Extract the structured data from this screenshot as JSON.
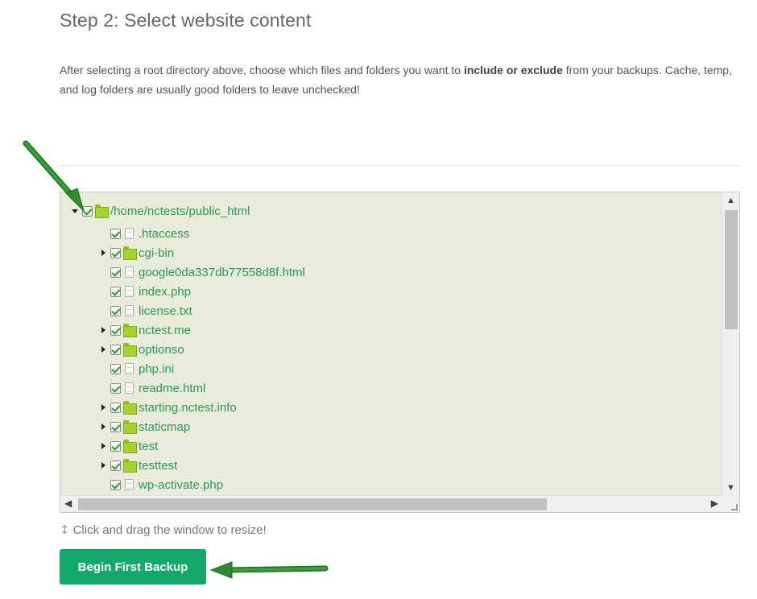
{
  "step": {
    "title": "Step 2: Select website content",
    "description_before": "After selecting a root directory above, choose which files and folders you want to ",
    "description_bold": "include or exclude",
    "description_after": " from your backups. Cache, temp, and log folders are usually good folders to leave unchecked!"
  },
  "tree": {
    "root": {
      "label": "/home/nctests/public_html",
      "icon": "folder-icon",
      "expanded": true,
      "checked": true
    },
    "items": [
      {
        "label": ".htaccess",
        "type": "file",
        "checked": true,
        "expandable": false
      },
      {
        "label": "cgi-bin",
        "type": "folder",
        "checked": true,
        "expandable": true
      },
      {
        "label": "google0da337db77558d8f.html",
        "type": "file",
        "checked": true,
        "expandable": false
      },
      {
        "label": "index.php",
        "type": "file",
        "checked": true,
        "expandable": false
      },
      {
        "label": "license.txt",
        "type": "file",
        "checked": true,
        "expandable": false
      },
      {
        "label": "nctest.me",
        "type": "folder",
        "checked": true,
        "expandable": true
      },
      {
        "label": "optionso",
        "type": "folder",
        "checked": true,
        "expandable": true
      },
      {
        "label": "php.ini",
        "type": "file",
        "checked": true,
        "expandable": false
      },
      {
        "label": "readme.html",
        "type": "file",
        "checked": true,
        "expandable": false
      },
      {
        "label": "starting.nctest.info",
        "type": "folder",
        "checked": true,
        "expandable": true
      },
      {
        "label": "staticmap",
        "type": "folder",
        "checked": true,
        "expandable": true
      },
      {
        "label": "test",
        "type": "folder",
        "checked": true,
        "expandable": true
      },
      {
        "label": "testtest",
        "type": "folder",
        "checked": true,
        "expandable": true
      },
      {
        "label": "wp-activate.php",
        "type": "file",
        "checked": true,
        "expandable": false
      }
    ]
  },
  "resize_hint": "Click and drag the window to resize!",
  "actions": {
    "begin_label": "Begin First Backup"
  },
  "colors": {
    "tree_background": "#e9ecda",
    "node_text": "#2a9a57",
    "button": "#14a86b",
    "annotation_arrow": "#2e8b2e"
  }
}
